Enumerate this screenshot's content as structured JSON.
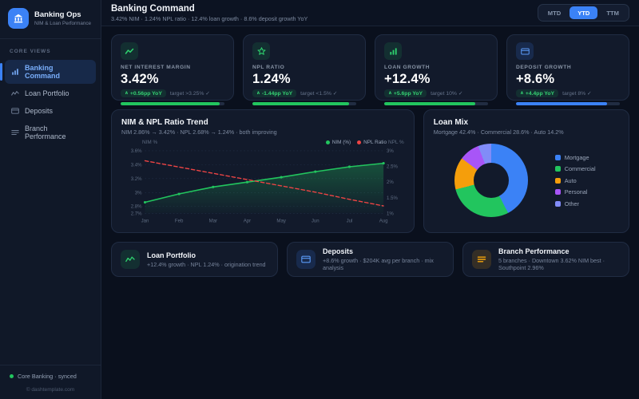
{
  "icons": {
    "trend_up_arrow": "∧"
  },
  "brand": {
    "title": "Banking Ops",
    "subtitle": "NIM & Loan Performance"
  },
  "sidebar": {
    "section_label": "CORE VIEWS",
    "items": [
      {
        "label": "Banking Command",
        "icon": "bar-chart-icon",
        "active": true
      },
      {
        "label": "Loan Portfolio",
        "icon": "pulse-icon",
        "active": false
      },
      {
        "label": "Deposits",
        "icon": "card-icon",
        "active": false
      },
      {
        "label": "Branch Performance",
        "icon": "list-icon",
        "active": false
      }
    ],
    "status": "Core Banking · synced",
    "copyright": "© dashtemplate.com"
  },
  "header": {
    "title": "Banking Command",
    "subtitle": "3.42% NIM · 1.24% NPL ratio · 12.4% loan growth · 8.6% deposit growth YoY",
    "range_buttons": [
      {
        "label": "MTD",
        "active": false
      },
      {
        "label": "YTD",
        "active": true
      },
      {
        "label": "TTM",
        "active": false
      }
    ]
  },
  "kpis": [
    {
      "label": "NET INTEREST MARGIN",
      "value": "3.42%",
      "delta": "+0.56pp YoY",
      "target": "target >3.25% ✓",
      "progress": 95,
      "bar_color": "#22c55e"
    },
    {
      "label": "NPL RATIO",
      "value": "1.24%",
      "delta": "-1.44pp YoY",
      "target": "target <1.5% ✓",
      "progress": 93,
      "bar_color": "#22c55e"
    },
    {
      "label": "LOAN GROWTH",
      "value": "+12.4%",
      "delta": "+5.6pp YoY",
      "target": "target 10% ✓",
      "progress": 88,
      "bar_color": "#22c55e"
    },
    {
      "label": "DEPOSIT GROWTH",
      "value": "+8.6%",
      "delta": "+4.4pp YoY",
      "target": "target 8% ✓",
      "progress": 88,
      "bar_color": "#3b82f6"
    }
  ],
  "chart_data": [
    {
      "type": "line",
      "title": "NIM & NPL Ratio Trend",
      "subtitle": "NIM 2.86% → 3.42% · NPL 2.68% → 1.24% · both improving",
      "x": [
        "Jan",
        "Feb",
        "Mar",
        "Apr",
        "May",
        "Jun",
        "Jul",
        "Aug"
      ],
      "series": [
        {
          "name": "NIM (%)",
          "axis": "left",
          "color": "#22c55e",
          "style": "solid-area",
          "values": [
            2.86,
            2.98,
            3.08,
            3.15,
            3.22,
            3.3,
            3.37,
            3.42
          ]
        },
        {
          "name": "NPL Ratio",
          "axis": "right",
          "color": "#ef4444",
          "style": "dashed",
          "values": [
            2.68,
            2.48,
            2.28,
            2.08,
            1.88,
            1.68,
            1.45,
            1.24
          ]
        }
      ],
      "left_axis": {
        "label": "NIM %",
        "min": 2.7,
        "max": 3.6,
        "ticks": [
          3.6,
          3.4,
          3.2,
          3.0,
          2.8,
          2.7
        ],
        "tick_labels": [
          "3.6%",
          "3.4%",
          "3.2%",
          "3%",
          "2.8%",
          "2.7%"
        ]
      },
      "right_axis": {
        "label": "NPL %",
        "min": 1,
        "max": 3,
        "ticks": [
          3,
          2.5,
          2,
          1.5,
          1
        ],
        "tick_labels": [
          "3%",
          "2.5%",
          "2%",
          "1.5%",
          "1%"
        ]
      },
      "grid": true,
      "legend_position": "top-right"
    },
    {
      "type": "pie",
      "donut": true,
      "title": "Loan Mix",
      "subtitle": "Mortgage 42.4% · Commercial 28.6% · Auto 14.2%",
      "labels": [
        "Mortgage",
        "Commercial",
        "Auto",
        "Personal",
        "Other"
      ],
      "values": [
        42.4,
        28.6,
        14.2,
        9.0,
        5.8
      ],
      "colors": [
        "#3b82f6",
        "#22c55e",
        "#f59e0b",
        "#a855f7",
        "#818cf8"
      ],
      "legend_position": "right"
    }
  ],
  "bottom_cards": [
    {
      "title": "Loan Portfolio",
      "subtitle": "+12.4% growth · NPL 1.24% · origination trend"
    },
    {
      "title": "Deposits",
      "subtitle": "+8.6% growth · $204K avg per branch · mix analysis"
    },
    {
      "title": "Branch Performance",
      "subtitle": "5 branches · Downtown 3.62% NIM best · Southpoint 2.96%"
    }
  ]
}
